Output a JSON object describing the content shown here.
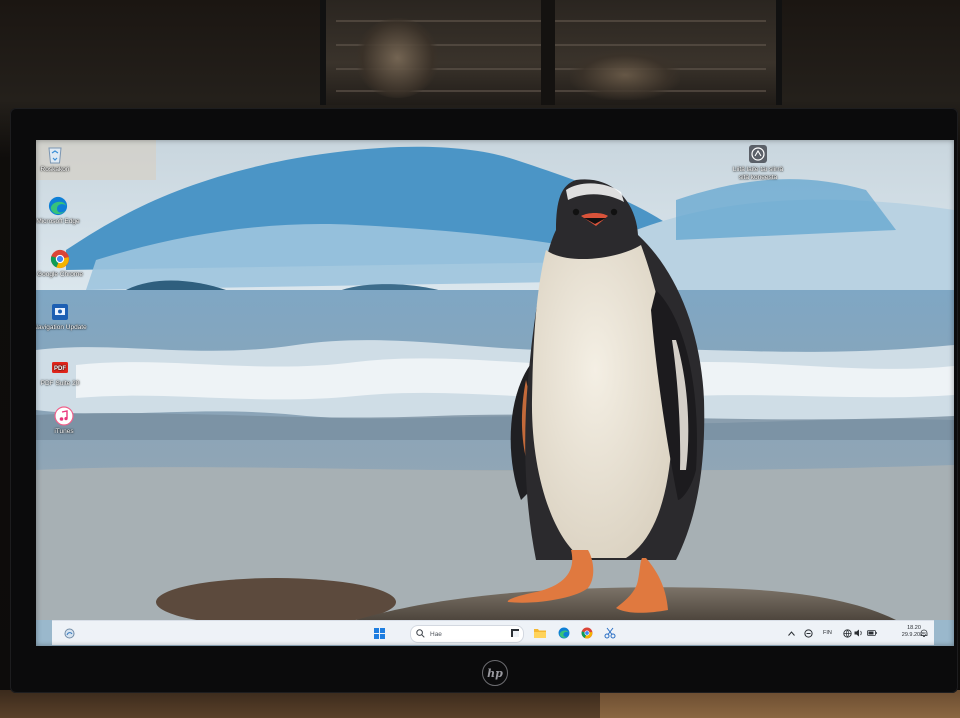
{
  "desktop": {
    "icons": [
      {
        "label": "Roskakori",
        "icon": "recycle-bin-icon"
      },
      {
        "label": "Microsoft Edge",
        "icon": "edge-icon"
      },
      {
        "label": "Google Chrome",
        "icon": "chrome-icon"
      },
      {
        "label": "Navigation Update",
        "icon": "navigation-update-icon"
      },
      {
        "label": "PDF Suite 20",
        "icon": "pdf-icon"
      },
      {
        "label": "iTunes",
        "icon": "itunes-icon"
      }
    ],
    "right_icon": {
      "label": "Liitä laite tai siirrä",
      "label_line2": "sitä koneesta",
      "icon": "phone-link-icon"
    }
  },
  "taskbar": {
    "widgets_icon": "widgets-icon",
    "start_icon": "windows-start-icon",
    "search_placeholder": "Hae",
    "pinned": [
      {
        "name": "task-view-icon"
      },
      {
        "name": "file-explorer-icon"
      },
      {
        "name": "edge-icon"
      },
      {
        "name": "chrome-icon"
      },
      {
        "name": "snipping-tool-icon"
      }
    ],
    "tray": {
      "chevron": "chevron-up-icon",
      "language": "FIN",
      "time": "18.20",
      "date": "29.9.2025"
    }
  },
  "monitor": {
    "brand": "hp"
  },
  "colors": {
    "taskbar_bg": "#eef2f7",
    "sky": "#8fb6d2",
    "ice": "#4f98c8",
    "sea": "#7f9bb0"
  }
}
